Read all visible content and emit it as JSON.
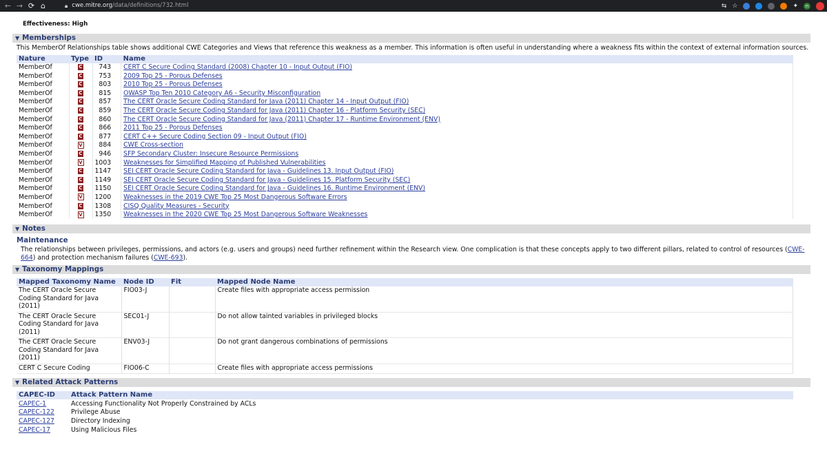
{
  "browser": {
    "url_host": "cwe.mitre.org",
    "url_path": "/data/definitions/732.html"
  },
  "effectiveness": "Effectiveness: High",
  "memberships": {
    "title": "Memberships",
    "description": "This MemberOf Relationships table shows additional CWE Categories and Views that reference this weakness as a member. This information is often useful in understanding where a weakness fits within the context of external information sources.",
    "headers": [
      "Nature",
      "Type",
      "ID",
      "Name"
    ],
    "rows": [
      {
        "nature": "MemberOf",
        "type": "C",
        "id": "743",
        "name": "CERT C Secure Coding Standard (2008) Chapter 10 - Input Output (FIO)"
      },
      {
        "nature": "MemberOf",
        "type": "C",
        "id": "753",
        "name": "2009 Top 25 - Porous Defenses"
      },
      {
        "nature": "MemberOf",
        "type": "C",
        "id": "803",
        "name": "2010 Top 25 - Porous Defenses"
      },
      {
        "nature": "MemberOf",
        "type": "C",
        "id": "815",
        "name": "OWASP Top Ten 2010 Category A6 - Security Misconfiguration"
      },
      {
        "nature": "MemberOf",
        "type": "C",
        "id": "857",
        "name": "The CERT Oracle Secure Coding Standard for Java (2011) Chapter 14 - Input Output (FIO)"
      },
      {
        "nature": "MemberOf",
        "type": "C",
        "id": "859",
        "name": "The CERT Oracle Secure Coding Standard for Java (2011) Chapter 16 - Platform Security (SEC)"
      },
      {
        "nature": "MemberOf",
        "type": "C",
        "id": "860",
        "name": "The CERT Oracle Secure Coding Standard for Java (2011) Chapter 17 - Runtime Environment (ENV)"
      },
      {
        "nature": "MemberOf",
        "type": "C",
        "id": "866",
        "name": "2011 Top 25 - Porous Defenses"
      },
      {
        "nature": "MemberOf",
        "type": "C",
        "id": "877",
        "name": "CERT C++ Secure Coding Section 09 - Input Output (FIO)"
      },
      {
        "nature": "MemberOf",
        "type": "V",
        "id": "884",
        "name": "CWE Cross-section"
      },
      {
        "nature": "MemberOf",
        "type": "C",
        "id": "946",
        "name": "SFP Secondary Cluster: Insecure Resource Permissions"
      },
      {
        "nature": "MemberOf",
        "type": "V",
        "id": "1003",
        "name": "Weaknesses for Simplified Mapping of Published Vulnerabilities"
      },
      {
        "nature": "MemberOf",
        "type": "C",
        "id": "1147",
        "name": "SEI CERT Oracle Secure Coding Standard for Java - Guidelines 13. Input Output (FIO)"
      },
      {
        "nature": "MemberOf",
        "type": "C",
        "id": "1149",
        "name": "SEI CERT Oracle Secure Coding Standard for Java - Guidelines 15. Platform Security (SEC)"
      },
      {
        "nature": "MemberOf",
        "type": "C",
        "id": "1150",
        "name": "SEI CERT Oracle Secure Coding Standard for Java - Guidelines 16. Runtime Environment (ENV)"
      },
      {
        "nature": "MemberOf",
        "type": "V",
        "id": "1200",
        "name": "Weaknesses in the 2019 CWE Top 25 Most Dangerous Software Errors"
      },
      {
        "nature": "MemberOf",
        "type": "C",
        "id": "1308",
        "name": "CISQ Quality Measures - Security"
      },
      {
        "nature": "MemberOf",
        "type": "V",
        "id": "1350",
        "name": "Weaknesses in the 2020 CWE Top 25 Most Dangerous Software Weaknesses"
      }
    ]
  },
  "notes": {
    "title": "Notes",
    "subtitle": "Maintenance",
    "text_before": "The relationships between privileges, permissions, and actors (e.g. users and groups) need further refinement within the Research view. One complication is that these concepts apply to two different pillars, related to control of resources (",
    "link1": "CWE-664",
    "text_middle": ") and protection mechanism failures (",
    "link2": "CWE-693",
    "text_after": ")."
  },
  "taxonomy": {
    "title": "Taxonomy Mappings",
    "headers": [
      "Mapped Taxonomy Name",
      "Node ID",
      "Fit",
      "Mapped Node Name"
    ],
    "rows": [
      {
        "taxonomy": "The CERT Oracle Secure Coding Standard for Java (2011)",
        "node_id": "FIO03-J",
        "fit": "",
        "node_name": "Create files with appropriate access permission"
      },
      {
        "taxonomy": "The CERT Oracle Secure Coding Standard for Java (2011)",
        "node_id": "SEC01-J",
        "fit": "",
        "node_name": "Do not allow tainted variables in privileged blocks"
      },
      {
        "taxonomy": "The CERT Oracle Secure Coding Standard for Java (2011)",
        "node_id": "ENV03-J",
        "fit": "",
        "node_name": "Do not grant dangerous combinations of permissions"
      },
      {
        "taxonomy": "CERT C Secure Coding",
        "node_id": "FIO06-C",
        "fit": "",
        "node_name": "Create files with appropriate access permissions"
      }
    ]
  },
  "attack_patterns": {
    "title": "Related Attack Patterns",
    "headers": [
      "CAPEC-ID",
      "Attack Pattern Name"
    ],
    "rows": [
      {
        "id": "CAPEC-1",
        "name": "Accessing Functionality Not Properly Constrained by ACLs"
      },
      {
        "id": "CAPEC-122",
        "name": "Privilege Abuse"
      },
      {
        "id": "CAPEC-127",
        "name": "Directory Indexing"
      },
      {
        "id": "CAPEC-17",
        "name": "Using Malicious Files"
      }
    ]
  }
}
